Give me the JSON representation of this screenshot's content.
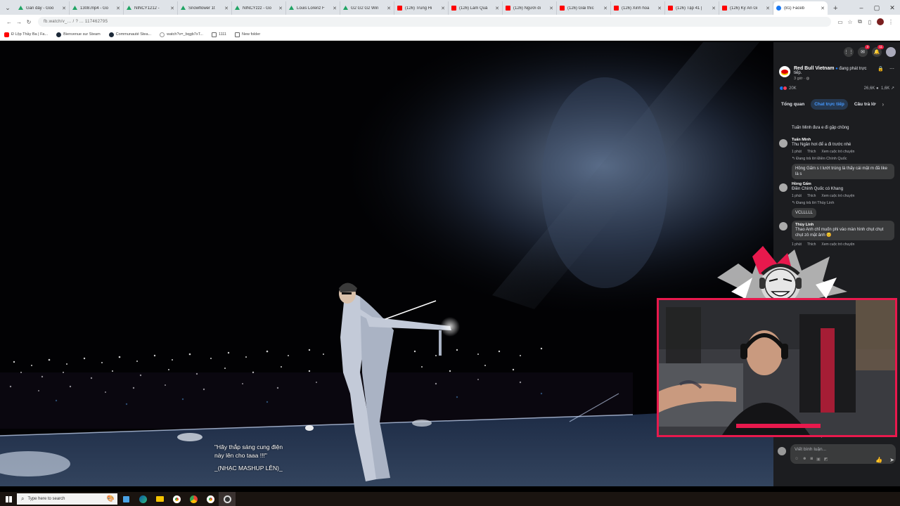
{
  "browser": {
    "tabs": [
      {
        "label": "Gần đây - Goo",
        "favicon": "google-drive-icon",
        "type": "d"
      },
      {
        "label": "1308.mp4 - Go",
        "favicon": "google-drive-icon",
        "type": "d"
      },
      {
        "label": "NINCY1212 - ",
        "favicon": "google-drive-icon",
        "type": "d"
      },
      {
        "label": "Snowflower 1t",
        "favicon": "google-drive-icon",
        "type": "d"
      },
      {
        "label": "NINCYzzz - Go",
        "favicon": "google-drive-icon",
        "type": "d"
      },
      {
        "label": "Louis Lorenz F",
        "favicon": "google-drive-icon",
        "type": "d"
      },
      {
        "label": "G2 G2 G2 Win",
        "favicon": "google-drive-icon",
        "type": "d"
      },
      {
        "label": "(126) Trung Hi",
        "favicon": "youtube-icon",
        "type": "y"
      },
      {
        "label": "(126) Làm Quả",
        "favicon": "youtube-icon",
        "type": "y"
      },
      {
        "label": "(126) Người đi",
        "favicon": "youtube-icon",
        "type": "y"
      },
      {
        "label": "(126) Giải thíc",
        "favicon": "youtube-icon",
        "type": "y"
      },
      {
        "label": "(126) Xinh hoa",
        "favicon": "youtube-icon",
        "type": "y"
      },
      {
        "label": "(126) Tập 41 |",
        "favicon": "youtube-icon",
        "type": "y"
      },
      {
        "label": "(126) Kỳ Án Gi",
        "favicon": "youtube-icon",
        "type": "y"
      },
      {
        "label": "(81) Faceb",
        "favicon": "facebook-icon",
        "type": "f",
        "active": true
      }
    ],
    "url": "fb.watch/v_...  /  ?  ... 117462795",
    "bookmarks": [
      {
        "label": "Đ Lộp Thầy Ba | Fa...",
        "icon": "youtube-icon",
        "type": "yt"
      },
      {
        "label": "Bienvenue sur Steam",
        "icon": "steam-icon",
        "type": "st"
      },
      {
        "label": "Communauté Stea...",
        "icon": "steam-icon",
        "type": "st"
      },
      {
        "label": "watch?v=_bqgb7xT...",
        "icon": "google-icon",
        "type": "gg"
      },
      {
        "label": "1111",
        "icon": "folder-icon",
        "type": "fd"
      },
      {
        "label": "New folder",
        "icon": "folder-icon",
        "type": "fd"
      }
    ]
  },
  "video": {
    "lyric_line1": "\"Hãy thắp sáng cung điện",
    "lyric_line2": "này lên cho taaa !!!\"",
    "lyric_line3": "_(NHẠC MASHUP LÊN)_"
  },
  "facebook": {
    "top_badges": {
      "messenger": "3",
      "notifications": "11"
    },
    "page_name": "Red Bull Vietnam",
    "status": "đang phát trực tiếp.",
    "time": "3 giờ · ",
    "reactions": "20K",
    "views": "26,6K",
    "shares": "1,6K",
    "tabs": [
      "Tổng quan",
      "Chat trực tiếp",
      "Câu trả lờ"
    ],
    "active_tab": 1,
    "comments": [
      {
        "author": "",
        "text": "Tuấn Minh đưa e đi gặp chồng",
        "actions": [],
        "reply": "",
        "bubble": false
      },
      {
        "author": "Tuấn Minh",
        "text": "Thu Ngân hơi để a đi trước nhé",
        "actions": [
          "1 phút",
          "Thích",
          "Xem cuộc trò chuyện"
        ],
        "reply": "Đang trả lời Điền Chính Quốc",
        "bubble": false
      },
      {
        "author": "",
        "text": "Hồng Gấm s t lướt trúng là thấy cái mặt m đã like là s",
        "actions": [],
        "reply": "",
        "bubble": true
      },
      {
        "author": "Hồng Gấm",
        "text": "Điền Chính Quốc có Khang",
        "actions": [
          "1 phút",
          "Thích",
          "Xem cuộc trò chuyện"
        ],
        "reply": "Đang trả lời Thùy Linh",
        "bubble": false
      },
      {
        "author": "",
        "text": "VCLLLLL",
        "actions": [],
        "reply": "",
        "bubble": true
      },
      {
        "author": "Thùy Linh",
        "text": "Thao Anh chỉ muốn phi vào màn hình chụt chụt chụt zô mặt ảnh 😊",
        "actions": [
          "1 phút",
          "Thích",
          "Xem cuộc trò chuyện"
        ],
        "reply": "",
        "bubble": true
      }
    ],
    "bottom_actions": [
      "15 phút",
      "Thích",
      "Trả lời",
      "29"
    ],
    "composer_placeholder": "Viết bình luận..."
  },
  "taskbar": {
    "search_placeholder": "Type here to search"
  }
}
